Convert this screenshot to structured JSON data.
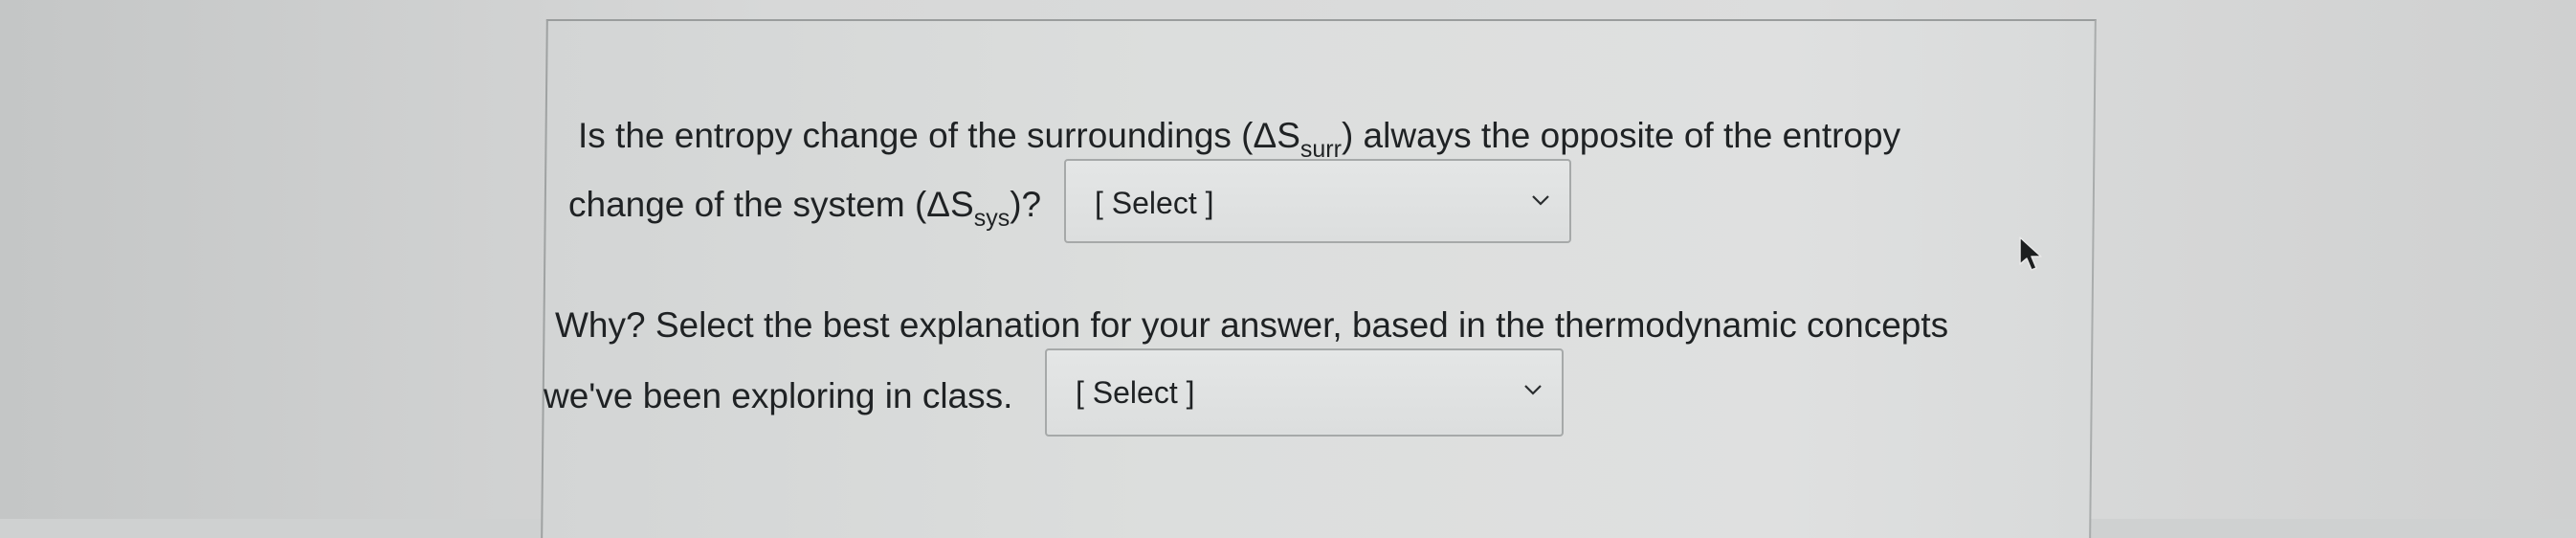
{
  "question1": {
    "line1_before": "Is the entropy change of the surroundings (ΔS",
    "line1_sub": "surr",
    "line1_after": ") always the opposite of the entropy",
    "line2_before": "change of the system (ΔS",
    "line2_sub": "sys",
    "line2_after": ")?",
    "select": {
      "value": "[ Select ]",
      "icon": "chevron-down-icon"
    }
  },
  "question2": {
    "line1": "Why? Select the best explanation for your answer, based in the thermodynamic concepts",
    "line2": "we've been exploring in class.",
    "select": {
      "value": "[ Select ]",
      "icon": "chevron-down-icon"
    }
  },
  "cursor": {
    "icon": "mouse-pointer-icon"
  }
}
